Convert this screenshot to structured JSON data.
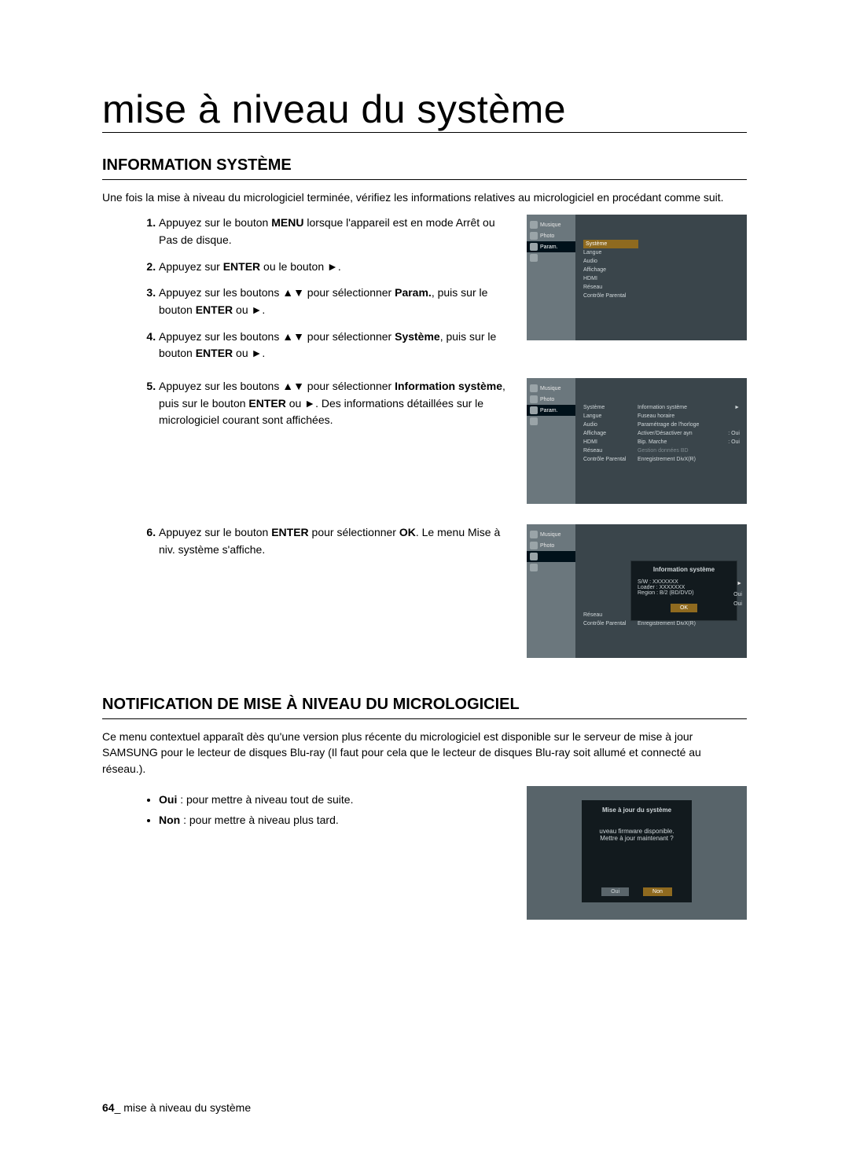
{
  "page_title": "mise à niveau du système",
  "section1_heading": "INFORMATION SYSTÈME",
  "section1_intro": "Une fois la mise à niveau du micrologiciel terminée, vérifiez les informations relatives au micrologiciel en procédant comme suit.",
  "step1_a": "Appuyez sur le bouton ",
  "step1_b": "MENU",
  "step1_c": " lorsque l'appareil est en mode Arrêt ou Pas de disque.",
  "step2_a": "Appuyez sur ",
  "step2_b": "ENTER",
  "step2_c": " ou le bouton ►.",
  "step3_a": "Appuyez sur les boutons ▲▼ pour sélectionner ",
  "step3_b": "Param.",
  "step3_c": ", puis sur le bouton ",
  "step3_d": "ENTER",
  "step3_e": " ou ►.",
  "step4_a": "Appuyez sur les boutons ▲▼ pour sélectionner ",
  "step4_b": "Système",
  "step4_c": ", puis sur le bouton ",
  "step4_d": "ENTER",
  "step4_e": " ou ►.",
  "step5_a": "Appuyez sur les boutons ▲▼ pour sélectionner ",
  "step5_b": "Information système",
  "step5_c": ", puis sur le bouton ",
  "step5_d": "ENTER",
  "step5_e": " ou ►. Des informations détaillées sur le micrologiciel courant sont affichées.",
  "step6_a": "Appuyez sur le bouton ",
  "step6_b": "ENTER",
  "step6_c": " pour sélectionner ",
  "step6_d": "OK",
  "step6_e": ". Le menu Mise à niv. système s'affiche.",
  "section2_heading": "NOTIFICATION DE MISE À NIVEAU DU MICROLOGICIEL",
  "section2_intro": "Ce menu contextuel apparaît dès qu'une version plus récente du micrologiciel est disponible sur le serveur de mise à jour SAMSUNG pour le lecteur de disques Blu-ray (Il faut pour cela que le lecteur de disques Blu-ray soit allumé et connecté au réseau.).",
  "bullet1_a": "Oui",
  "bullet1_b": " : pour mettre à niveau tout de suite.",
  "bullet2_a": "Non",
  "bullet2_b": " : pour mettre à niveau plus tard.",
  "footer_num": "64",
  "footer_sep": "_ ",
  "footer_text": "mise à niveau du système",
  "shot": {
    "side_musique": "Musique",
    "side_photo": "Photo",
    "side_param": "Param.",
    "menu_systeme": "Système",
    "menu_langue": "Langue",
    "menu_audio": "Audio",
    "menu_affichage": "Affichage",
    "menu_hdmi": "HDMI",
    "menu_reseau": "Réseau",
    "menu_parental": "Contrôle Parental",
    "sub_info": "Information système",
    "sub_fuseau": "Fuseau horaire",
    "sub_horloge": "Paramétrage de l'horloge",
    "sub_anynet": "Activer/Désactiver ayn",
    "sub_bip": "Bip. Marche",
    "sub_gestion": "Gestion données BD",
    "sub_divx": "Enregistrement DivX(R)",
    "val_oui": "Oui",
    "ov_title": "Information système",
    "ov_sw": "S/W : XXXXXXX",
    "ov_loader": "Loader : XXXXXXX",
    "ov_region": "Region : B/2 (BD/DVD)",
    "ov_ok": "OK",
    "pop_title": "Mise à jour du système",
    "pop_line1": "uveau firmware disponible.",
    "pop_line2": "Mettre à jour maintenant ?",
    "pop_oui": "Oui",
    "pop_non": "Non"
  }
}
